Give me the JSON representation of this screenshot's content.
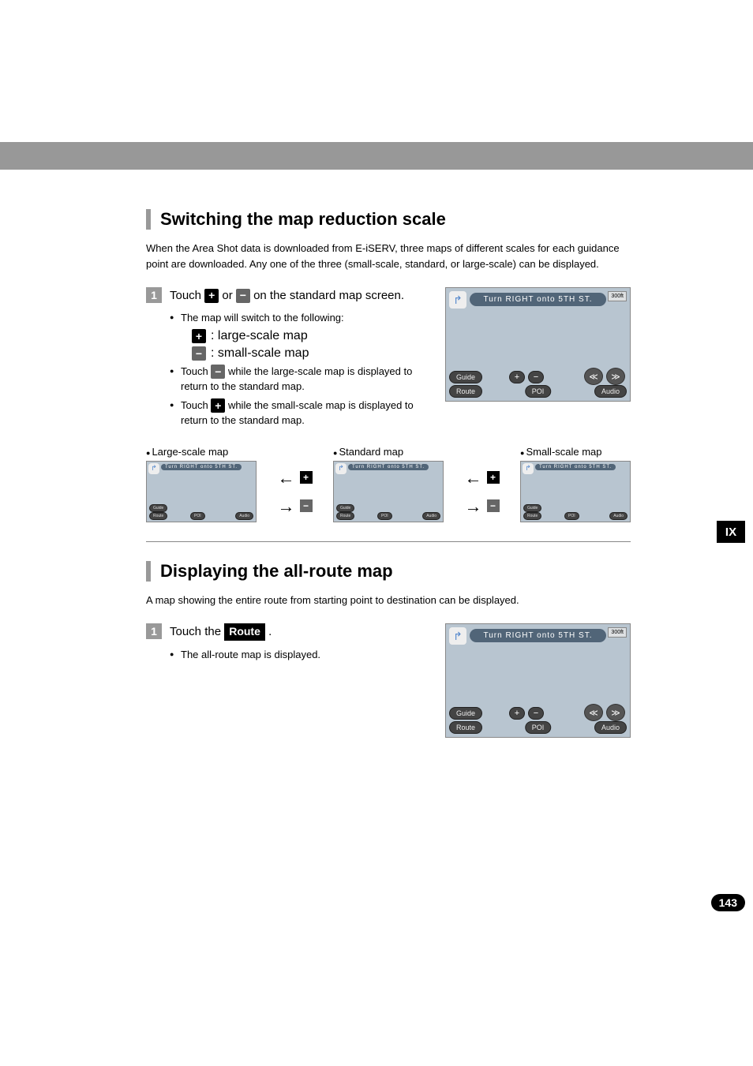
{
  "section1": {
    "heading": "Switching the map reduction scale",
    "intro": "When the Area Shot data is downloaded from E-iSERV, three maps of different scales for each guidance point are downloaded. Any one of the three  (small-scale, standard, or large-scale) can be displayed.",
    "step_num": "1",
    "step_text_a": "Touch ",
    "step_text_b": " or ",
    "step_text_c": " on the standard map screen.",
    "bullets": {
      "switch": "The map will switch to the following:",
      "large_scale": " : large-scale map",
      "small_scale": " : small-scale map",
      "touch_minus_a": "Touch ",
      "touch_minus_b": " while the large-scale map is displayed to return to the standard map.",
      "touch_plus_a": "Touch ",
      "touch_plus_b": " while the small-scale map is displayed to return to the standard map."
    },
    "map_labels": {
      "large": "Large-scale map",
      "standard": "Standard map",
      "small": "Small-scale map"
    }
  },
  "screenshot": {
    "direction": "Turn RIGHT onto 5TH ST.",
    "scale": "300ft",
    "guide": "Guide",
    "route": "Route",
    "poi": "POI",
    "audio": "Audio",
    "plus": "+",
    "minus": "−"
  },
  "section2": {
    "heading": "Displaying the all-route map",
    "intro": "A map showing the entire route from starting point to destination can be displayed.",
    "step_num": "1",
    "step_text_a": "Touch the ",
    "route_label": "Route",
    "step_text_b": " .",
    "bullet": "The all-route map is displayed."
  },
  "chapter": "IX",
  "page": "143"
}
